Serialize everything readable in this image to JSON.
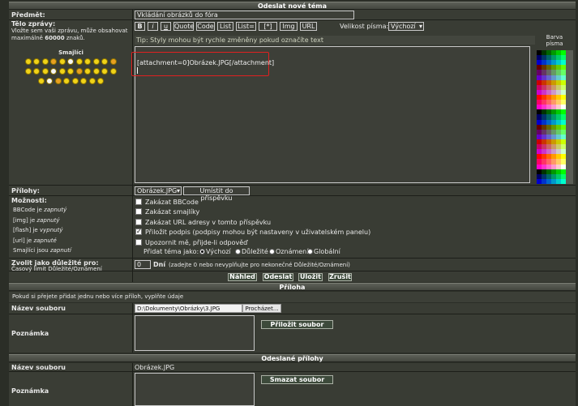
{
  "header": {
    "title": "Odeslat nové téma"
  },
  "subject": {
    "label": "Předmět:",
    "value": "Vkládání obrázků do fóra"
  },
  "body": {
    "label": "Tělo zprávy:",
    "hint_1": "Vložte sem vaši zprávu, může obsahovat",
    "hint_2_prefix": "maximálně",
    "hint_2_max": "60000",
    "hint_2_suffix": "znaků."
  },
  "smilies": {
    "label": "Smajlíci",
    "rows": [
      11,
      11,
      8
    ]
  },
  "toolbar": {
    "buttons": [
      "B",
      "i",
      "u",
      "Quote",
      "Code",
      "List",
      "List=",
      "[*]",
      "Img",
      "URL"
    ],
    "font_size_label": "Velikost písma:",
    "font_size_value": "Výchozí"
  },
  "tip": "Tip: Styly mohou být rychle změněny pokud označíte text",
  "editor": {
    "content": "[attachment=0]Obrázek.JPG[/attachment]"
  },
  "color_panel": {
    "label_1": "Barva",
    "label_2": "písma"
  },
  "attachments_row": {
    "label": "Přílohy:",
    "select_value": "Obrázek.JPG",
    "place_button": "Umístit do příspěvku"
  },
  "options": {
    "label": "Možnosti:",
    "status": [
      {
        "prefix": "",
        "name": "BBCode",
        "word": "je",
        "state": "zapnutý"
      },
      {
        "prefix": "",
        "name": "[img]",
        "word": "je",
        "state": "zapnutý"
      },
      {
        "prefix": "",
        "name": "[flash]",
        "word": "je",
        "state": "vypnutý"
      },
      {
        "prefix": "",
        "name": "[url]",
        "word": "je",
        "state": "zapnuté"
      },
      {
        "prefix": "",
        "name": "Smajlíci",
        "word": "jsou",
        "state": "zapnutí"
      }
    ],
    "checks": [
      {
        "label": "Zakázat BBCode",
        "checked": false
      },
      {
        "label": "Zakázat smajlíky",
        "checked": false
      },
      {
        "label": "Zakázat URL adresy v tomto příspěvku",
        "checked": false
      },
      {
        "label": "Přiložit podpis (podpisy mohou být nastaveny v uživatelském panelu)",
        "checked": true
      },
      {
        "label": "Upozornit mě, přijde-li odpověď",
        "checked": false
      }
    ],
    "topic_type_label": "Přidat téma jako:",
    "topic_types": [
      {
        "label": "Výchozí",
        "selected": true
      },
      {
        "label": "Důležité",
        "selected": false
      },
      {
        "label": "Oznámení",
        "selected": false
      },
      {
        "label": "Globální",
        "selected": false
      }
    ]
  },
  "sticky": {
    "label": "Zvolit jako důležité pro:",
    "sub": "Časový limit Důležité/Oznámení",
    "value": "0",
    "unit": "Dní",
    "hint": "(zadejte 0 nebo nevyplňujte pro nekonečné Důležité/Oznámení)"
  },
  "actions": {
    "preview": "Náhled",
    "submit": "Odeslat",
    "save": "Uložit",
    "cancel": "Zrušit"
  },
  "attach_section": {
    "title": "Příloha",
    "hint": "Pokud si přejete přidat jednu nebo více příloh, vyplňte údaje",
    "filename_label": "Název souboru",
    "filename_value": "D:\\Dokumenty\\Obrázky\\3.JPG",
    "browse": "Procházet...",
    "note_label": "Poznámka",
    "add_button": "Přiložit soubor"
  },
  "posted_section": {
    "title": "Odeslané přílohy",
    "filename_label": "Název souboru",
    "filename_value": "Obrázek.JPG",
    "note_label": "Poznámka",
    "delete_button": "Smazat soubor"
  },
  "colors": {
    "highlight": "#e02020",
    "checked": "#000000"
  }
}
